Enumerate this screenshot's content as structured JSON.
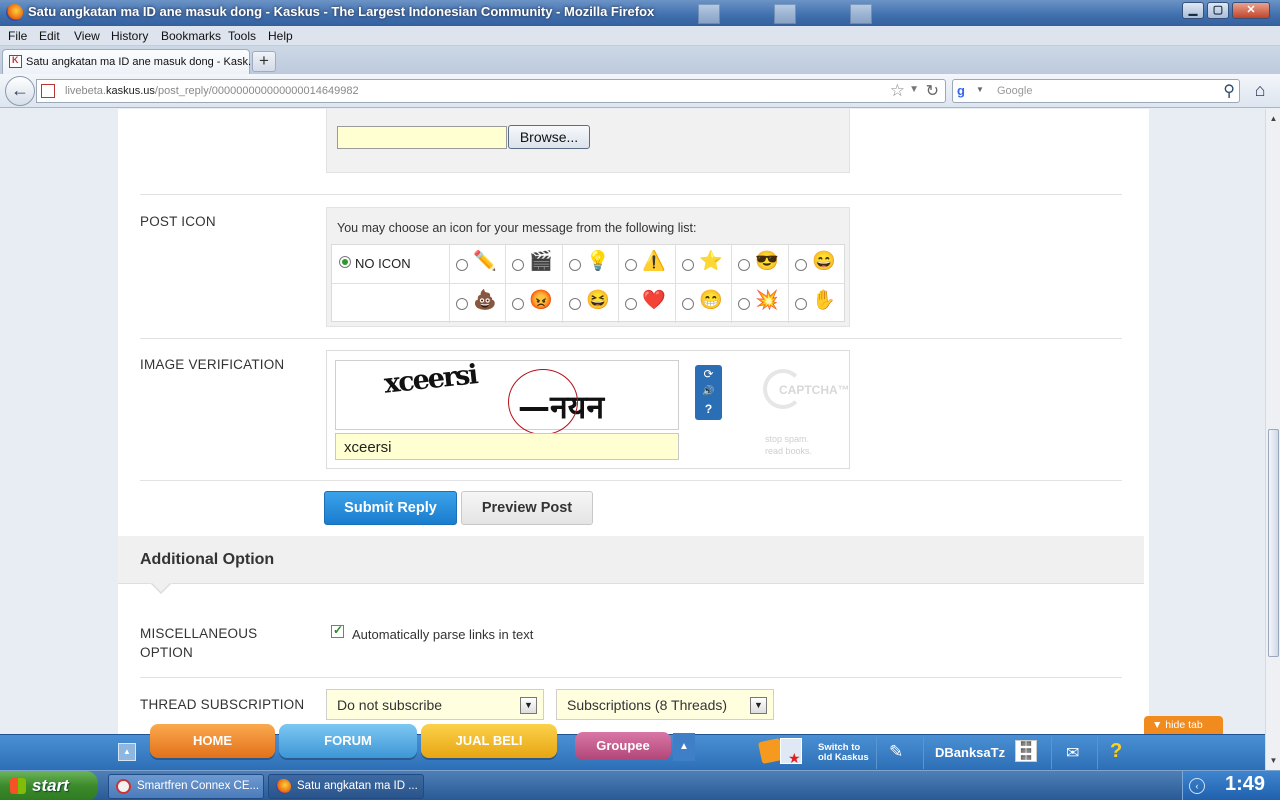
{
  "window": {
    "title": "Satu angkatan ma ID ane masuk dong - Kaskus - The Largest Indonesian Community - Mozilla Firefox",
    "controls": {
      "minimize": "▁",
      "maximize": "▢",
      "close": "✕"
    }
  },
  "menu": [
    "File",
    "Edit",
    "View",
    "History",
    "Bookmarks",
    "Tools",
    "Help"
  ],
  "tab": {
    "label": "Satu angkatan ma ID ane masuk dong - Kask...",
    "new_tab": "+"
  },
  "navbar": {
    "back": "←",
    "url_host_prefix": "livebeta.",
    "url_host": "kaskus.us",
    "url_path": "/post_reply/000000000000000014649982",
    "search_placeholder": "Google",
    "search_engine_icon": "g",
    "search_icon": "⚲",
    "home_icon": "⌂",
    "bookmark_icon": "☆",
    "reload_icon": "↻"
  },
  "form": {
    "upload": {
      "browse_label": "Browse..."
    },
    "post_icon": {
      "label": "POST ICON",
      "hint": "You may choose an icon for your message from the following list:",
      "no_icon_label": "NO ICON",
      "selected": "no-icon",
      "icons_row1": [
        "✏️",
        "🎬",
        "💡",
        "⚠️",
        "⭐",
        "😎",
        "😄"
      ],
      "icons_row2": [
        "💩",
        "😡",
        "😆",
        "❤️",
        "😁",
        "💥",
        "✋"
      ]
    },
    "image_verification": {
      "label": "IMAGE VERIFICATION",
      "captcha_word1": "xceersi",
      "captcha_word2": "—नयन",
      "value": "xceersi",
      "controls": [
        "⟳",
        "🔊",
        "?"
      ],
      "logo_text": "CAPTCHA™",
      "tagline_1": "stop spam.",
      "tagline_2": "read books."
    },
    "submit_label": "Submit Reply",
    "preview_label": "Preview Post",
    "additional_option": {
      "title": "Additional Option",
      "misc_label_1": "MISCELLANEOUS",
      "misc_label_2": "OPTION",
      "parse_links_label": "Automatically parse links in text",
      "parse_links_checked": true,
      "thread_subscription_label": "THREAD SUBSCRIPTION",
      "subscribe_value": "Do not subscribe",
      "subscriptions_value": "Subscriptions (8 Threads)"
    }
  },
  "kaskus_bar": {
    "up": "▲",
    "home": "HOME",
    "forum": "FORUM",
    "jual_beli": "JUAL BELI",
    "groupee": "Groupee",
    "groupee_arrow": "▲",
    "switch_line1": "Switch to",
    "switch_line2": "old Kaskus",
    "username": "DBanksaTz",
    "notes_icon": "✎",
    "mail_icon": "✉",
    "help_icon": "?",
    "hide_tab": "▼  hide tab"
  },
  "taskbar": {
    "start": "start",
    "task1": "Smartfren Connex CE...",
    "task2": "Satu angkatan ma ID ...",
    "clock": "1:49",
    "tray_chevron": "‹"
  },
  "colors": {
    "submit": "#1b7ccd",
    "captcha_input_bg": "#ffffd2",
    "kaskus_bar": "#2d6fb6",
    "hide_tab": "#f28b1e"
  }
}
